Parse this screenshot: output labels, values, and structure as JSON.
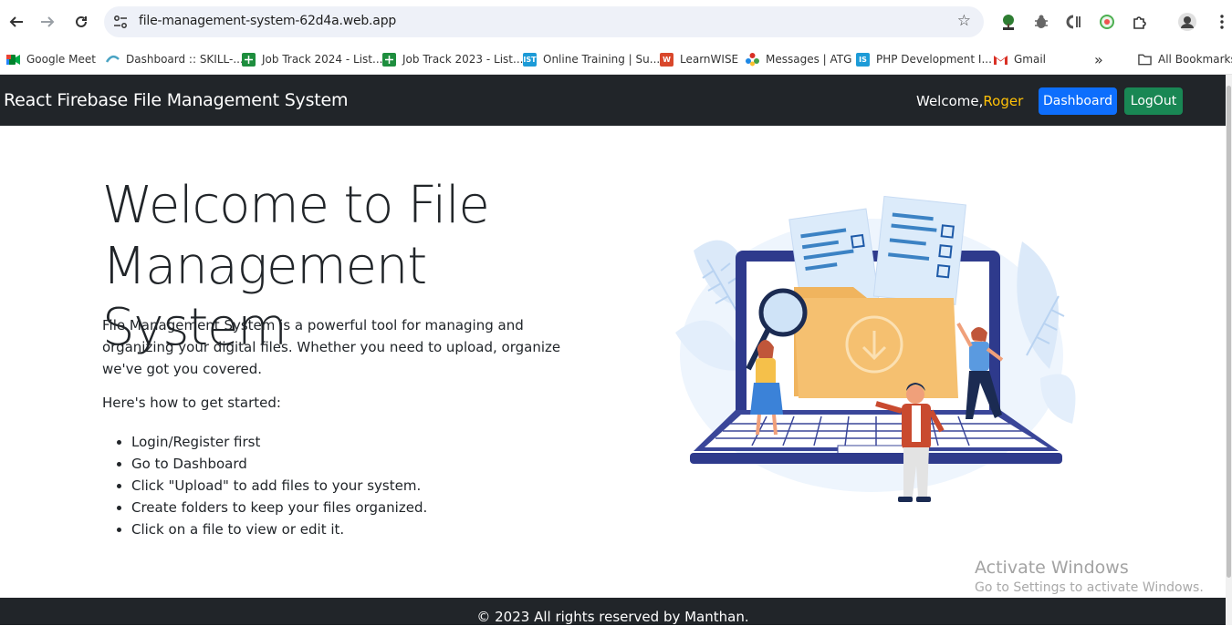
{
  "browser": {
    "url": "file-management-system-62d4a.web.app",
    "bookmarks": [
      {
        "label": "Google Meet",
        "icon": "google-meet-icon",
        "color": "#00897b"
      },
      {
        "label": "Dashboard :: SKILL-...",
        "icon": "skill-icon",
        "color": "#4aa3c3"
      },
      {
        "label": "Job Track 2024 - List...",
        "icon": "sheets-icon",
        "color": "#1e8e3e"
      },
      {
        "label": "Job Track 2023 - List...",
        "icon": "sheets-icon",
        "color": "#1e8e3e"
      },
      {
        "label": "Online Training | Su...",
        "icon": "ist-icon",
        "color": "#1d9bd7"
      },
      {
        "label": "LearnWISE",
        "icon": "learnwise-icon",
        "color": "#d9472b"
      },
      {
        "label": "Messages | ATG",
        "icon": "atg-icon",
        "color": "#d93025"
      },
      {
        "label": "PHP Development I...",
        "icon": "is-icon",
        "color": "#1d9bd7"
      },
      {
        "label": "Gmail",
        "icon": "gmail-icon",
        "color": "#d93025"
      }
    ],
    "all_bookmarks_label": "All Bookmarks",
    "fav_labels": {
      "ist": "IST",
      "is": "IS",
      "w": "W",
      "m": "M"
    }
  },
  "header": {
    "brand": "React Firebase File Management System",
    "welcome_prefix": "Welcome,",
    "user_name": "Roger",
    "dashboard_label": "Dashboard",
    "logout_label": "LogOut"
  },
  "main": {
    "title": "Welcome to File Management System",
    "intro": "File Management System is a powerful tool for managing and organizing your digital files. Whether you need to upload, organize we've got you covered.",
    "started_label": "Here's how to get started:",
    "steps": [
      "Login/Register first",
      "Go to Dashboard",
      "Click \"Upload\" to add files to your system.",
      "Create folders to keep your files organized.",
      "Click on a file to view or edit it."
    ]
  },
  "watermark": {
    "line1": "Activate Windows",
    "line2": "Go to Settings to activate Windows."
  },
  "footer": {
    "text": "© 2023 All rights reserved by Manthan."
  },
  "colors": {
    "navbar": "#212529",
    "primary": "#0d6efd",
    "success": "#198754",
    "username": "#ffc107"
  }
}
